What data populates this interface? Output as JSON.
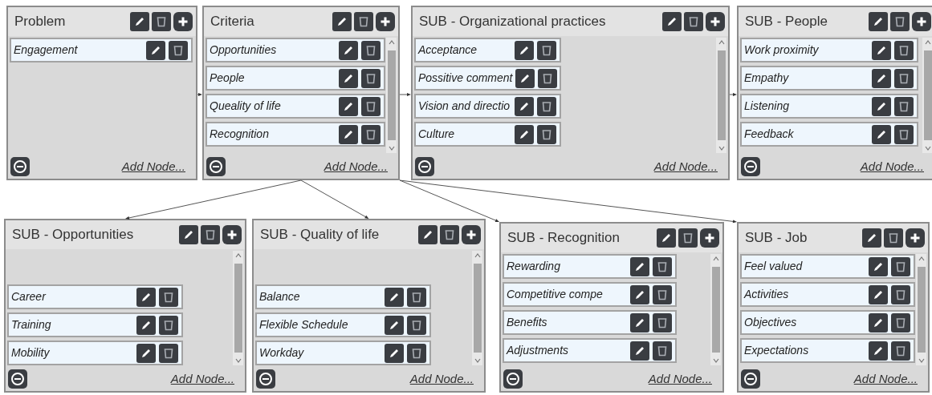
{
  "diagram": {
    "root": {
      "title": "Problem",
      "scrollable": false,
      "items": [
        {
          "label": "Engagement"
        }
      ],
      "add_link": "Add Node...",
      "children": [
        {
          "title": "Criteria",
          "scrollable": true,
          "items": [
            {
              "label": "Opportunities"
            },
            {
              "label": "People"
            },
            {
              "label": "Queality of life"
            },
            {
              "label": "Recognition"
            }
          ],
          "add_link": "Add Node...",
          "children": [
            {
              "title": "SUB - Organizational practices",
              "scrollable": true,
              "items": [
                {
                  "label": "Acceptance"
                },
                {
                  "label": "Possitive comment"
                },
                {
                  "label": "Vision and directio"
                },
                {
                  "label": "Culture"
                }
              ],
              "add_link": "Add Node...",
              "children": [
                {
                  "title": "SUB - People",
                  "scrollable": true,
                  "items": [
                    {
                      "label": "Work proximity"
                    },
                    {
                      "label": "Empathy"
                    },
                    {
                      "label": "Listening"
                    },
                    {
                      "label": "Feedback"
                    }
                  ],
                  "add_link": "Add Node..."
                }
              ]
            },
            {
              "title": "SUB - Opportunities",
              "scrollable": true,
              "items": [
                {
                  "label": "Career"
                },
                {
                  "label": "Training"
                },
                {
                  "label": "Mobility"
                }
              ],
              "add_link": "Add Node..."
            },
            {
              "title": "SUB - Quality of life",
              "scrollable": true,
              "items": [
                {
                  "label": "Balance"
                },
                {
                  "label": "Flexible Schedule"
                },
                {
                  "label": "Workday"
                }
              ],
              "add_link": "Add Node..."
            },
            {
              "title": "SUB - Recognition",
              "scrollable": true,
              "items": [
                {
                  "label": "Rewarding"
                },
                {
                  "label": "Competitive compe"
                },
                {
                  "label": "Benefits"
                },
                {
                  "label": "Adjustments"
                }
              ],
              "add_link": "Add Node..."
            },
            {
              "title": "SUB - Job",
              "scrollable": true,
              "items": [
                {
                  "label": "Feel valued"
                },
                {
                  "label": "Activities"
                },
                {
                  "label": "Objectives"
                },
                {
                  "label": "Expectations"
                }
              ],
              "add_link": "Add Node..."
            }
          ]
        }
      ]
    }
  }
}
